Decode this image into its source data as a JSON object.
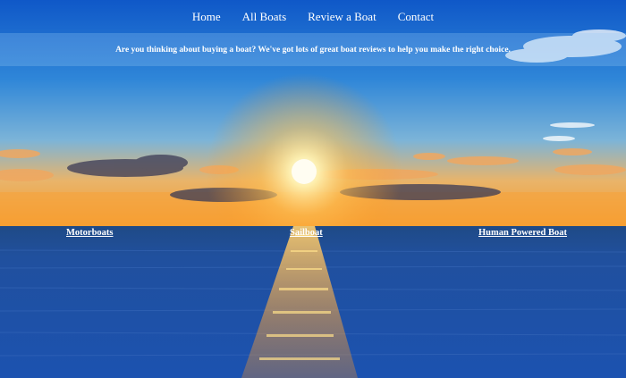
{
  "nav": {
    "items": [
      {
        "label": "Home"
      },
      {
        "label": "All Boats"
      },
      {
        "label": "Review a Boat"
      },
      {
        "label": "Contact"
      }
    ]
  },
  "banner": {
    "tagline": "Are you thinking about buying a boat? We've got lots of great boat reviews to help you make the right choice."
  },
  "categories": [
    {
      "label": "Motorboats"
    },
    {
      "label": "Sailboat"
    },
    {
      "label": "Human Powered Boat"
    }
  ],
  "colors": {
    "sky_top": "#1a63c8",
    "horizon_glow": "#f5a028",
    "sea": "#1d4f9e",
    "text": "#ffffff"
  }
}
